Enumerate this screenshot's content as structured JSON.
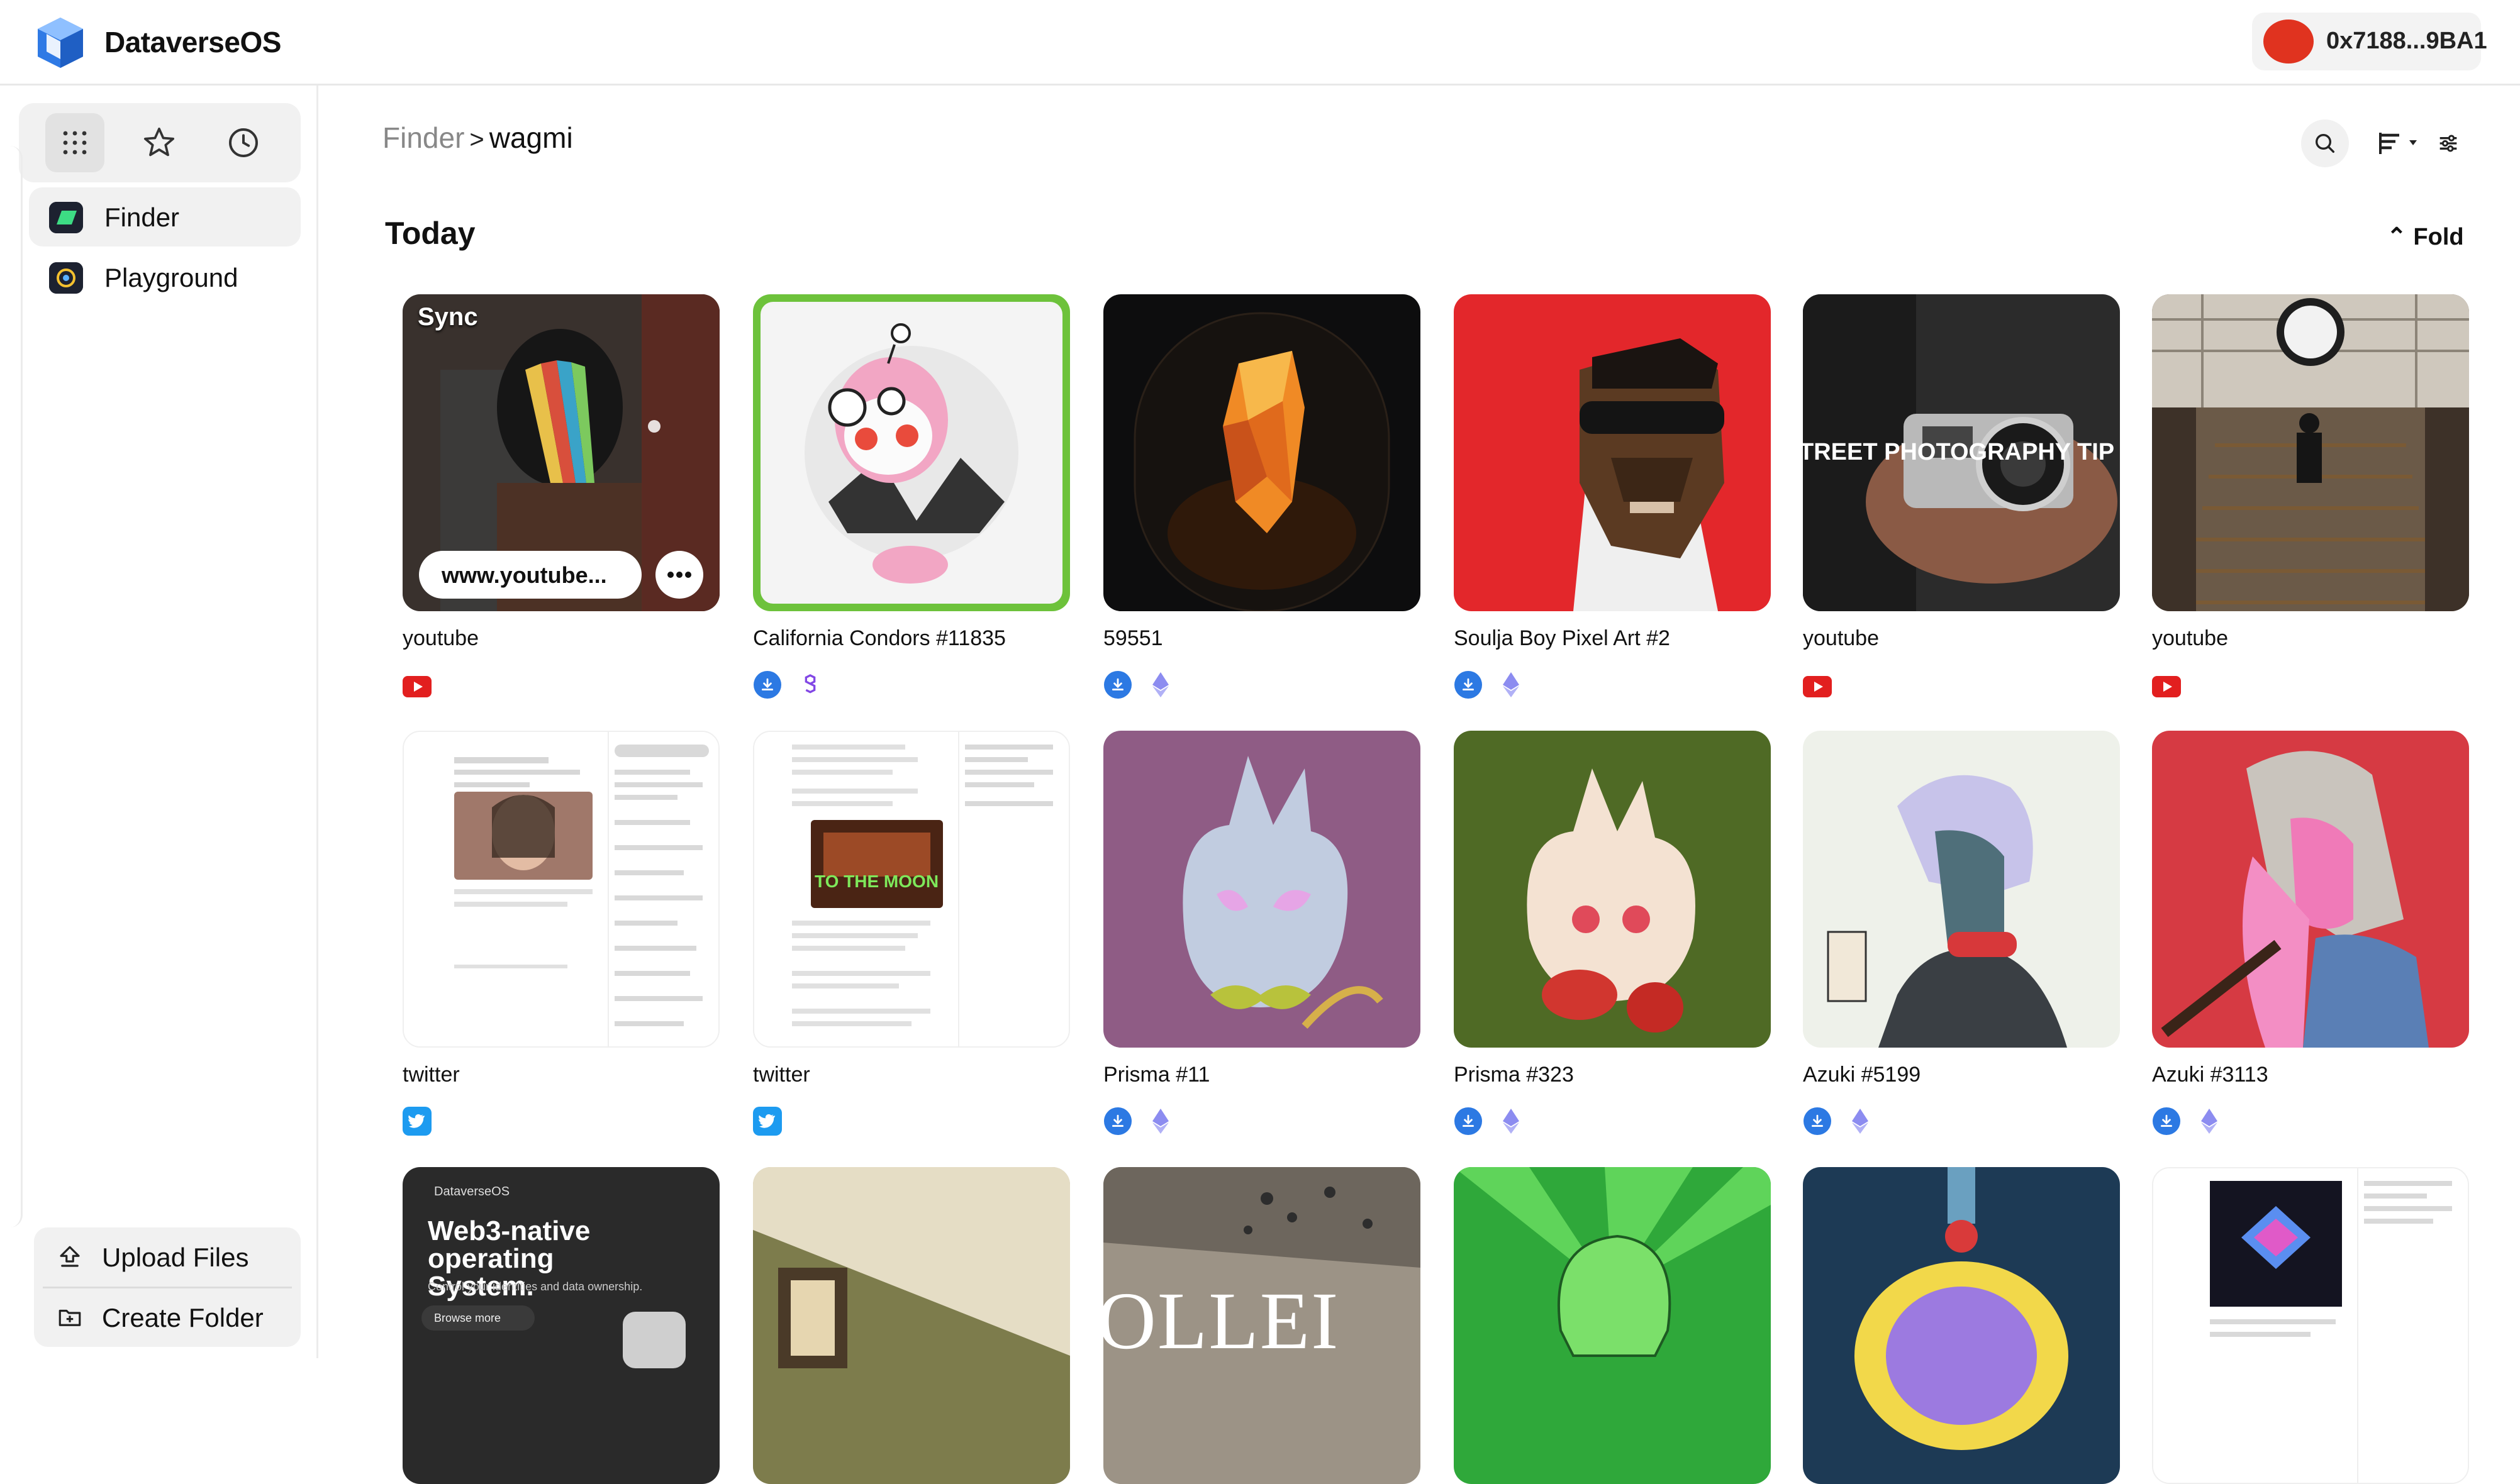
{
  "app": {
    "name": "DataverseOS"
  },
  "wallet": {
    "address": "0x7188...9BA1",
    "avatar_color": "#e0331f"
  },
  "sidebar": {
    "view_icons": [
      "grid-icon",
      "star-icon",
      "clock-icon"
    ],
    "items": [
      {
        "label": "Finder",
        "active": true
      },
      {
        "label": "Playground",
        "active": false
      }
    ],
    "actions": {
      "upload": "Upload Files",
      "create_folder": "Create Folder"
    }
  },
  "breadcrumb": {
    "root": "Finder",
    "separator": ">",
    "current": "wagmi"
  },
  "section": {
    "title": "Today",
    "fold_label": "Fold"
  },
  "cards": [
    {
      "title": "youtube",
      "source": "youtube",
      "overlay_label": "www.youtube...",
      "thumb_text": "Sync"
    },
    {
      "title": "California Condors #11835",
      "source": "nft-polygon"
    },
    {
      "title": "59551",
      "source": "nft-eth"
    },
    {
      "title": "Soulja Boy Pixel Art #2",
      "source": "nft-eth"
    },
    {
      "title": "youtube",
      "source": "youtube",
      "thumb_text": "TREET PHOTOGRAPHY TIP"
    },
    {
      "title": "youtube",
      "source": "youtube"
    },
    {
      "title": "twitter",
      "source": "twitter"
    },
    {
      "title": "twitter",
      "source": "twitter",
      "thumb_text": "TO THE MOON"
    },
    {
      "title": "Prisma #11",
      "source": "nft-eth"
    },
    {
      "title": "Prisma #323",
      "source": "nft-eth"
    },
    {
      "title": "Azuki #5199",
      "source": "nft-eth"
    },
    {
      "title": "Azuki #3113",
      "source": "nft-eth"
    },
    {
      "title": "",
      "source": "",
      "thumb_text": "Web3-native operating System.",
      "thumb_sub": "Control your identities and data ownership.",
      "thumb_brand": "DataverseOS",
      "thumb_button": "Browse more"
    },
    {
      "title": "",
      "source": ""
    },
    {
      "title": "",
      "source": "",
      "thumb_text": "OLLEI"
    },
    {
      "title": "",
      "source": ""
    },
    {
      "title": "",
      "source": ""
    },
    {
      "title": "",
      "source": ""
    }
  ],
  "colors": {
    "youtube": "#e21f1f",
    "twitter": "#1d9bf0",
    "storage": "#2c79e3",
    "accent": "#111111"
  }
}
